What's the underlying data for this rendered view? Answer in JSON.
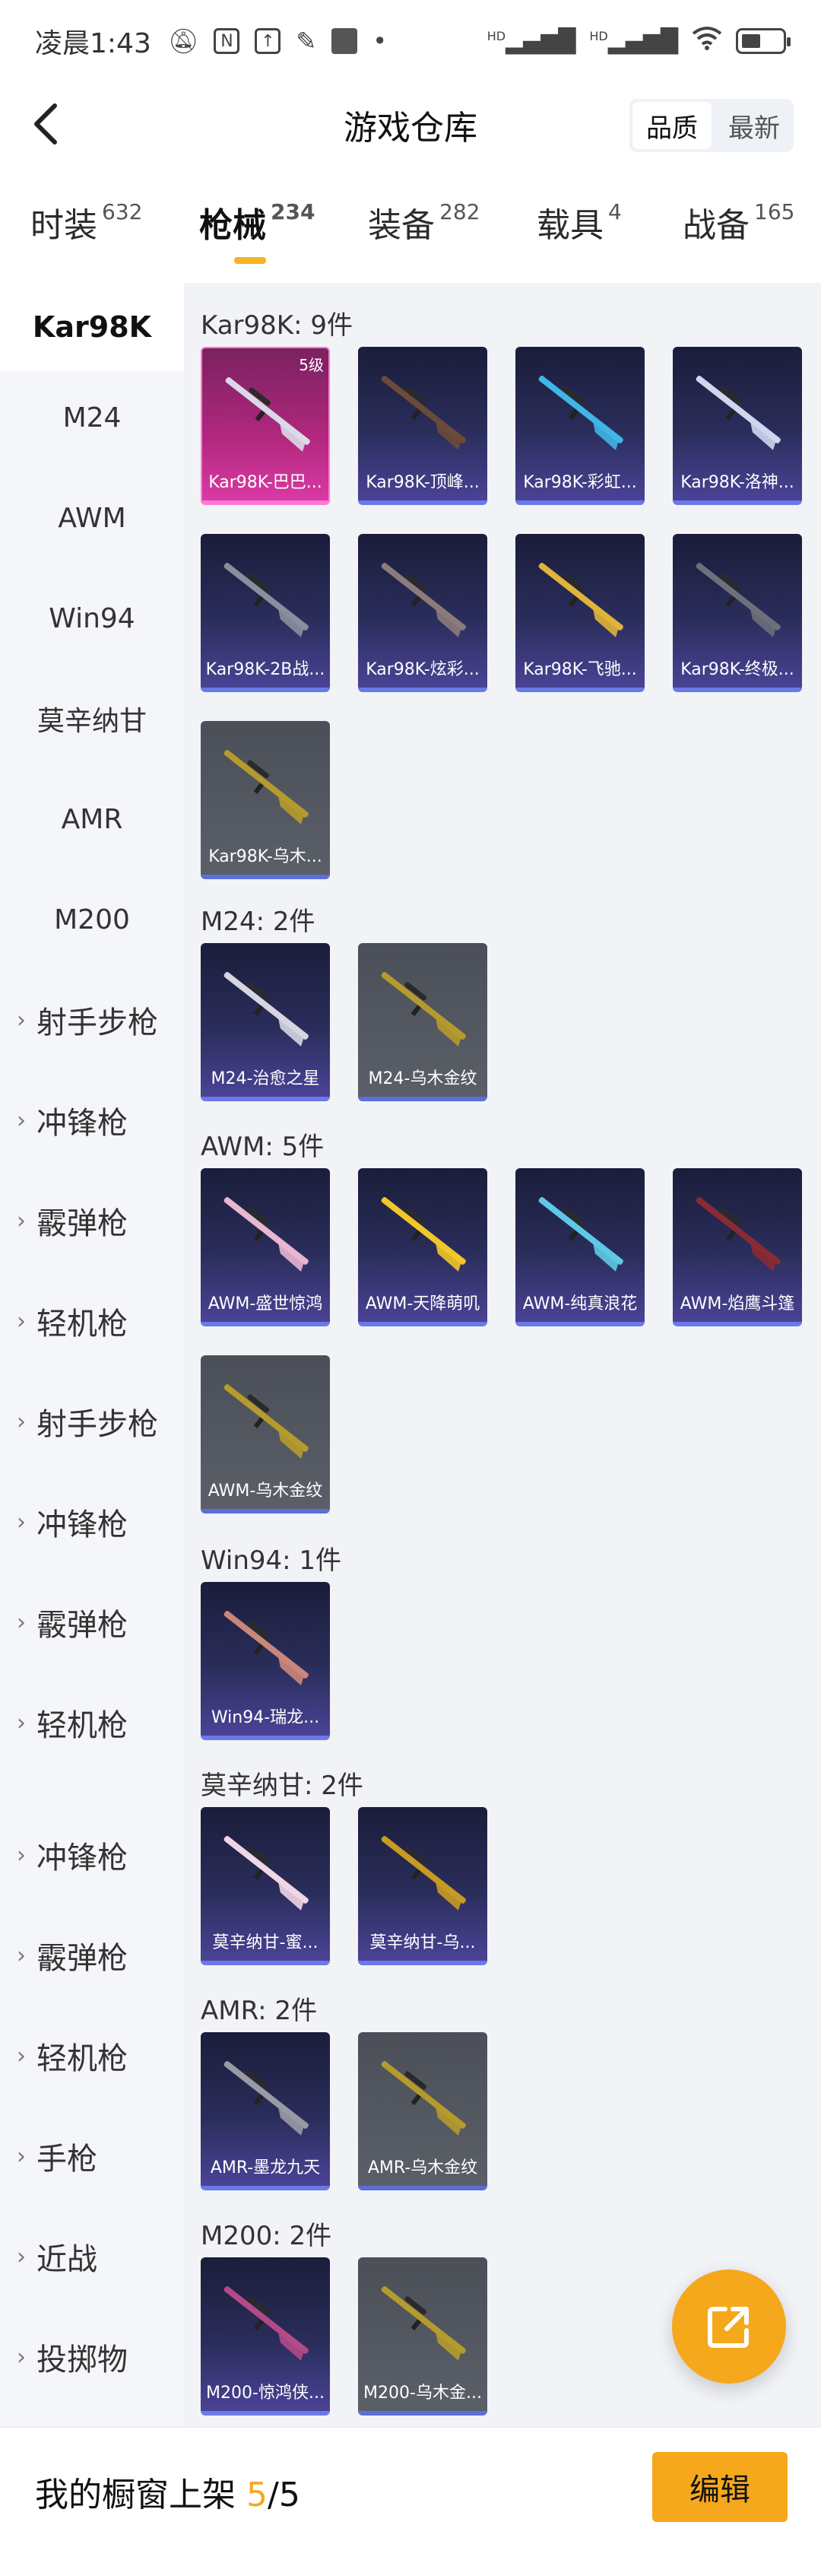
{
  "status_bar": {
    "time": "凌晨1:43",
    "icons": [
      "mute-icon",
      "nfc-icon",
      "upload-icon",
      "app-icon",
      "app-square-icon",
      "dot-icon"
    ],
    "right_icons": [
      "hd-signal-icon",
      "hd-signal-icon",
      "wifi-icon",
      "battery-icon"
    ],
    "hd_label_1": "HD",
    "hd_label_2": "HD"
  },
  "header": {
    "title": "游戏仓库",
    "sort_options": [
      "品质",
      "最新"
    ],
    "sort_selected": "品质"
  },
  "tabs": [
    {
      "label": "时装",
      "count": "632"
    },
    {
      "label": "枪械",
      "count": "234",
      "active": true
    },
    {
      "label": "装备",
      "count": "282"
    },
    {
      "label": "载具",
      "count": "4"
    },
    {
      "label": "战备",
      "count": "165"
    }
  ],
  "sidebar": {
    "items": [
      {
        "label": "Kar98K",
        "active": true
      },
      {
        "label": "M24"
      },
      {
        "label": "AWM"
      },
      {
        "label": "Win94"
      },
      {
        "label": "莫辛纳甘"
      },
      {
        "label": "AMR"
      },
      {
        "label": "M200"
      },
      {
        "label": "射手步枪",
        "group": true
      },
      {
        "label": "冲锋枪",
        "group": true
      },
      {
        "label": "霰弹枪",
        "group": true
      },
      {
        "label": "轻机枪",
        "group": true
      },
      {
        "label": "射手步枪",
        "group": true
      },
      {
        "label": "冲锋枪",
        "group": true
      },
      {
        "label": "霰弹枪",
        "group": true
      },
      {
        "label": "轻机枪",
        "group": true
      },
      {
        "label": "冲锋枪",
        "group": true
      },
      {
        "label": "霰弹枪",
        "group": true
      },
      {
        "label": "轻机枪",
        "group": true
      },
      {
        "label": "手枪",
        "group": true
      },
      {
        "label": "近战",
        "group": true
      },
      {
        "label": "投掷物",
        "group": true
      }
    ]
  },
  "sections": [
    {
      "title": "Kar98K: 9件",
      "items": [
        {
          "name": "Kar98K-巴巴...",
          "level": "5级",
          "style": "pink",
          "accent": "#d9d9e8"
        },
        {
          "name": "Kar98K-顶峰...",
          "style": "purple",
          "accent": "#6b4a3a"
        },
        {
          "name": "Kar98K-彩虹...",
          "style": "purple",
          "accent": "#3fb6e6"
        },
        {
          "name": "Kar98K-洛神...",
          "style": "purple",
          "accent": "#cfd6ee"
        },
        {
          "name": "Kar98K-2B战...",
          "style": "purple",
          "accent": "#8a8f9e"
        },
        {
          "name": "Kar98K-炫彩...",
          "style": "purple",
          "accent": "#8c7b7b"
        },
        {
          "name": "Kar98K-飞驰...",
          "style": "purple",
          "accent": "#e0b43a"
        },
        {
          "name": "Kar98K-终极...",
          "style": "purple",
          "accent": "#6e6f78"
        },
        {
          "name": "Kar98K-乌木...",
          "style": "gray",
          "accent": "#b59a2d"
        }
      ]
    },
    {
      "title": "M24: 2件",
      "items": [
        {
          "name": "M24-治愈之星",
          "style": "purple",
          "accent": "#d6d6e2"
        },
        {
          "name": "M24-乌木金纹",
          "style": "gray",
          "accent": "#b59a2d"
        }
      ]
    },
    {
      "title": "AWM: 5件",
      "items": [
        {
          "name": "AWM-盛世惊鸿",
          "style": "purple",
          "accent": "#e8b6cf"
        },
        {
          "name": "AWM-天降萌叽",
          "style": "purple",
          "accent": "#f1c62a"
        },
        {
          "name": "AWM-纯真浪花",
          "style": "purple",
          "accent": "#5ec9e6"
        },
        {
          "name": "AWM-焰鹰斗篷",
          "style": "purple",
          "accent": "#8a2a34"
        },
        {
          "name": "AWM-乌木金纹",
          "style": "gray",
          "accent": "#b59a2d"
        }
      ]
    },
    {
      "title": "Win94: 1件",
      "items": [
        {
          "name": "Win94-瑞龙...",
          "style": "purple",
          "accent": "#c9877a"
        }
      ]
    },
    {
      "title": "莫辛纳甘: 2件",
      "items": [
        {
          "name": "莫辛纳甘-蜜...",
          "style": "purple",
          "accent": "#f0d6e6"
        },
        {
          "name": "莫辛纳甘-乌...",
          "style": "purple",
          "accent": "#c89a22"
        }
      ]
    },
    {
      "title": "AMR: 2件",
      "items": [
        {
          "name": "AMR-墨龙九天",
          "style": "purple",
          "accent": "#9a9aa4"
        },
        {
          "name": "AMR-乌木金纹",
          "style": "gray",
          "accent": "#b59a2d"
        }
      ]
    },
    {
      "title": "M200: 2件",
      "items": [
        {
          "name": "M200-惊鸿侠...",
          "style": "purple",
          "accent": "#b24a8a"
        },
        {
          "name": "M200-乌木金...",
          "style": "gray",
          "accent": "#b59a2d"
        }
      ]
    }
  ],
  "bottom": {
    "showcase_label": "我的橱窗上架",
    "showcase_current": "5",
    "showcase_total": "/5",
    "edit_label": "编辑"
  }
}
